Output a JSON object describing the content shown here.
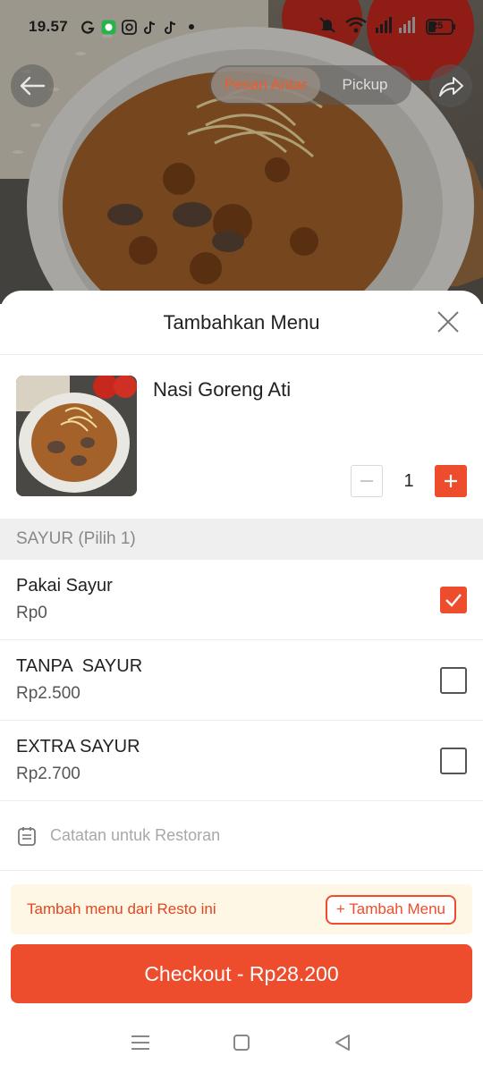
{
  "status_bar": {
    "time": "19.57",
    "battery": "25"
  },
  "top_nav": {
    "tabs": [
      {
        "label": "Pesan Antar",
        "active": true
      },
      {
        "label": "Pickup",
        "active": false
      }
    ]
  },
  "sheet": {
    "title": "Tambahkan Menu",
    "item": {
      "name": "Nasi Goreng Ati",
      "quantity": "1"
    },
    "section": {
      "title": "SAYUR (Pilih 1)",
      "options": [
        {
          "name": "Pakai Sayur",
          "price": "Rp0",
          "checked": true
        },
        {
          "name": "TANPA  SAYUR",
          "price": "Rp2.500",
          "checked": false
        },
        {
          "name": "EXTRA SAYUR",
          "price": "Rp2.700",
          "checked": false
        }
      ]
    },
    "note_placeholder": "Catatan untuk Restoran",
    "add_more": {
      "text": "Tambah menu dari Resto ini",
      "button_label": "+ Tambah Menu"
    },
    "checkout_label": "Checkout - Rp28.200"
  },
  "colors": {
    "accent": "#ee4d2d",
    "banner_bg": "#fff7e6"
  }
}
